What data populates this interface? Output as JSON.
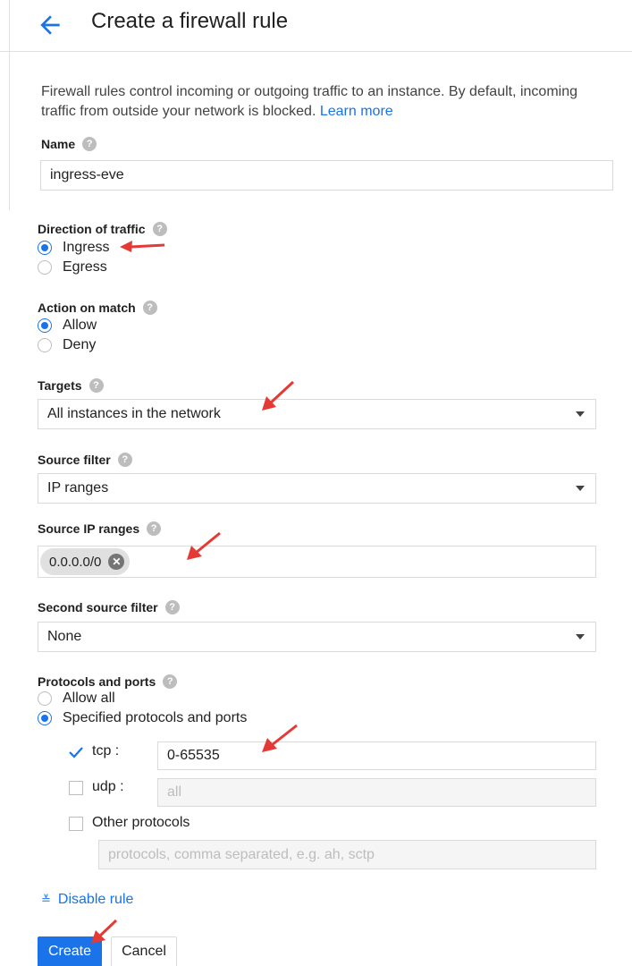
{
  "header": {
    "title": "Create a firewall rule"
  },
  "description": {
    "text": "Firewall rules control incoming or outgoing traffic to an instance. By default, incoming traffic from outside your network is blocked.",
    "link": "Learn more"
  },
  "name": {
    "label": "Name",
    "value": "ingress-eve"
  },
  "direction": {
    "label": "Direction of traffic",
    "options": [
      "Ingress",
      "Egress"
    ],
    "selected": "Ingress"
  },
  "action": {
    "label": "Action on match",
    "options": [
      "Allow",
      "Deny"
    ],
    "selected": "Allow"
  },
  "targets": {
    "label": "Targets",
    "value": "All instances in the network"
  },
  "source_filter": {
    "label": "Source filter",
    "value": "IP ranges"
  },
  "source_ip_ranges": {
    "label": "Source IP ranges",
    "chips": [
      "0.0.0.0/0"
    ]
  },
  "second_source_filter": {
    "label": "Second source filter",
    "value": "None"
  },
  "protocols": {
    "label": "Protocols and ports",
    "options": [
      "Allow all",
      "Specified protocols and ports"
    ],
    "selected": "Specified protocols and ports",
    "tcp": {
      "label": "tcp :",
      "checked": true,
      "value": "0-65535"
    },
    "udp": {
      "label": "udp :",
      "checked": false,
      "placeholder": "all"
    },
    "other": {
      "label": "Other protocols",
      "checked": false,
      "placeholder": "protocols, comma separated, e.g. ah, sctp"
    }
  },
  "disable_rule": "Disable rule",
  "buttons": {
    "create": "Create",
    "cancel": "Cancel"
  },
  "icons": {
    "back": "arrow-left-icon",
    "help": "question-circle-icon",
    "chip_remove": "close-circle-icon",
    "expand": "chevron-double-down-icon",
    "annotation": "red-arrow-icon"
  },
  "colors": {
    "accent": "#1a73e8",
    "annotation": "#e53935"
  }
}
